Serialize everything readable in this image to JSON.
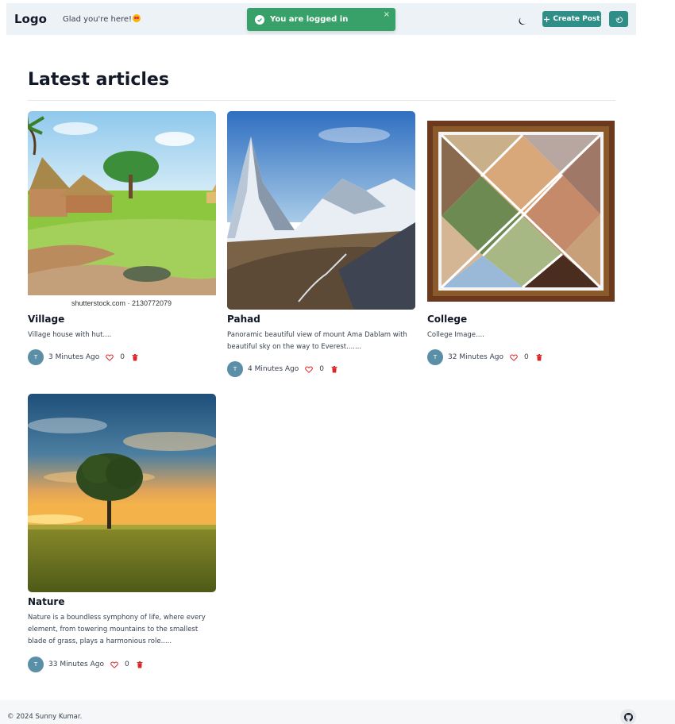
{
  "navbar": {
    "logo": "Logo",
    "greeting": "Glad you're here!",
    "greeting_emoji": "heart-eyes-emoji",
    "theme_icon": "moon-icon",
    "create_post_label": "Create Post",
    "logout_icon": "logout-icon"
  },
  "toast": {
    "message": "You are logged in",
    "close": "×",
    "color": "#38a169"
  },
  "main": {
    "title": "Latest articles"
  },
  "articles": [
    {
      "title": "Village",
      "description": "Village house with hut....",
      "avatar": "T",
      "time": "3 Minutes Ago",
      "likes": "0",
      "image_caption": "shutterstock.com · 2130772079"
    },
    {
      "title": "Pahad",
      "description": "Panoramic beautiful view of mount Ama Dablam with beautiful sky on the way to Everest.......",
      "avatar": "T",
      "time": "4 Minutes Ago",
      "likes": "0"
    },
    {
      "title": "College",
      "description": "College Image....",
      "avatar": "T",
      "time": "32 Minutes Ago",
      "likes": "0"
    },
    {
      "title": "Nature",
      "description": "Nature is a boundless symphony of life, where every element, from towering mountains to the smallest blade of grass, plays a harmonious role.....",
      "avatar": "T",
      "time": "33 Minutes Ago",
      "likes": "0"
    }
  ],
  "footer": {
    "copyright": "© 2024 Sunny Kumar.",
    "github_icon": "github-icon"
  },
  "colors": {
    "accent": "#2f8f88",
    "navbar_bg": "#edf2f6",
    "danger": "#dc2626"
  }
}
